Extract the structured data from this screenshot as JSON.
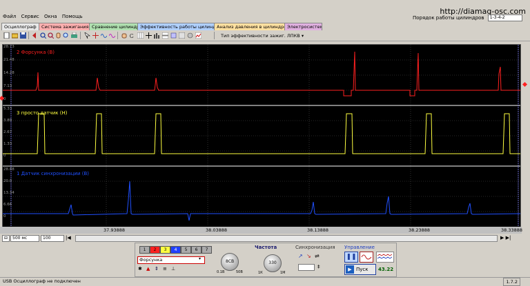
{
  "menu": {
    "items": [
      "Файл",
      "Сервис",
      "Окна",
      "Помощь"
    ]
  },
  "site_label": "http://diamag-osc.com",
  "order": {
    "label": "Порядок работы цилиндров",
    "value": "1-3-4-2"
  },
  "tabs": [
    {
      "label": "Осциллограф",
      "color": "#e8e8e8"
    },
    {
      "label": "Система зажигания",
      "color": "#ffb0b0"
    },
    {
      "label": "Сравнение цилиндров",
      "color": "#b0e0b0"
    },
    {
      "label": "Эффективность работы цилиндров",
      "color": "#b0d0ff"
    },
    {
      "label": "Анализ давления в цилиндре",
      "color": "#ffe0a0"
    },
    {
      "label": "Электросистема",
      "color": "#e0b0e0"
    }
  ],
  "toolbar": {
    "measure_label": "Тип эффективности зажиг. ЛПКВ"
  },
  "channels": [
    {
      "label": "2 Форсунка (В)",
      "color": "#ff2020",
      "ticks": [
        "28.73",
        "21.48",
        "14.28",
        "7.13",
        "0"
      ]
    },
    {
      "label": "3 просто датчик (Н)",
      "color": "#ffff40",
      "ticks": [
        "5.33",
        "3.89",
        "2.67",
        "1.33",
        "0"
      ]
    },
    {
      "label": "1 Датчик синхронизации (В)",
      "color": "#2040ff",
      "ticks": [
        "28.88",
        "20.0",
        "13.34",
        "6.66",
        "0"
      ]
    }
  ],
  "x_ticks": [
    "37.93888",
    "38.03888",
    "38.13888",
    "38.23888",
    "38.33888"
  ],
  "bottom": {
    "timebase": "500 мс",
    "points": "100"
  },
  "panel": {
    "channel_buttons": [
      "1",
      "2",
      "3",
      "4",
      "5",
      "6",
      "7"
    ],
    "channel_colors": [
      "#aaaaaa",
      "#ff2020",
      "#ffff40",
      "#2040ff",
      "#aaaaaa",
      "#aaaaaa",
      "#aaaaaa"
    ],
    "channel_select": "Форсунка",
    "freq_title": "Частота",
    "sync_title": "Синхронизация",
    "control_title": "Управление",
    "knob1": "8CB",
    "knob2": "330",
    "knob1_min": "0.1В",
    "knob1_max": "50В",
    "knob2_min": "1К",
    "knob2_max": "1М",
    "start_label": "Пуск",
    "rate": "43.22"
  },
  "status": {
    "text": "USB Осциллограф не подключен",
    "version": "1.7.2"
  }
}
